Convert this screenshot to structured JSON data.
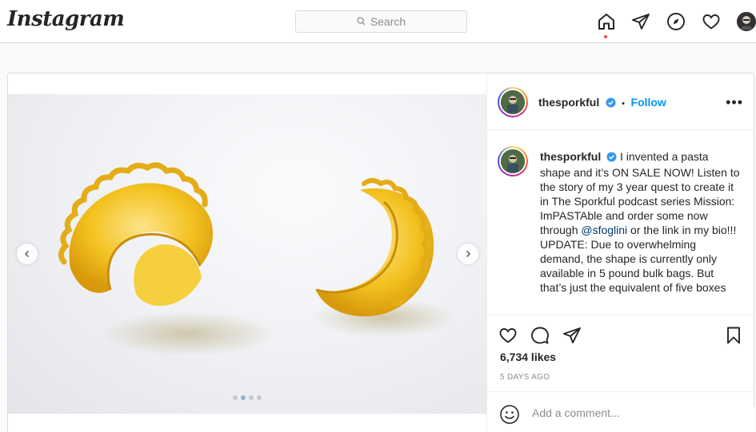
{
  "nav": {
    "logo": "Instagram",
    "search_placeholder": "Search"
  },
  "post": {
    "username": "thesporkful",
    "follow_label": "Follow",
    "separator": "•",
    "more_label": "•••",
    "caption": {
      "username": "thesporkful",
      "text_before_mention": "I invented a pasta shape and it’s ON SALE NOW! Listen to the story of my 3 year quest to create it in The Sporkful podcast series Mission: ImPASTAble and order some now through ",
      "mention": "@sfoglini",
      "text_after_mention": " or the link in my bio!!!",
      "update": "UPDATE: Due to overwhelming demand, the shape is currently only available in 5 pound bulk bags. But that’s just the equivalent of five boxes"
    },
    "likes": "6,734 likes",
    "timestamp": "5 DAYS AGO",
    "comment_placeholder": "Add a comment..."
  },
  "carousel": {
    "slide_count": 4,
    "active_index": 1
  },
  "colors": {
    "accent": "#0095f6",
    "notification": "#ed4956",
    "pasta": "#f3c21f"
  }
}
